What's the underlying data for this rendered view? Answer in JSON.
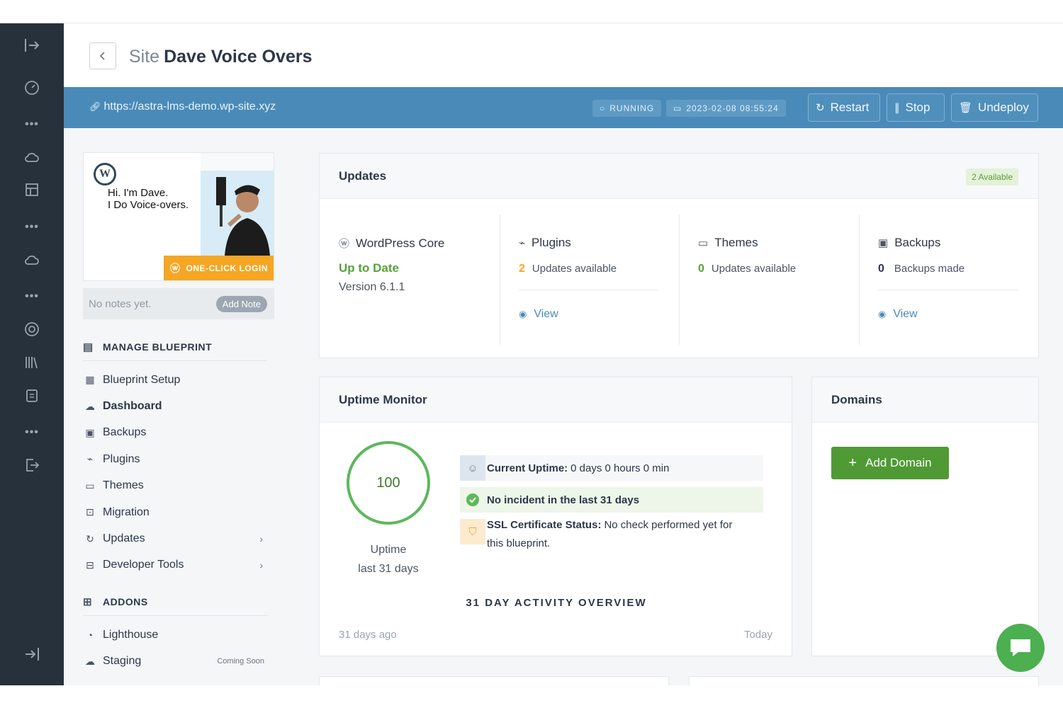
{
  "page": {
    "title_prefix": "Site",
    "title": "Dave Voice Overs"
  },
  "bar": {
    "url": "https://astra-lms-demo.wp-site.xyz",
    "status": "RUNNING",
    "timestamp": "2023-02-08 08:55:24",
    "restart": "Restart",
    "stop": "Stop",
    "undeploy": "Undeploy"
  },
  "preview": {
    "headline_1": "Hi. I'm Dave.",
    "headline_2": "I Do Voice-overs.",
    "one_click": "ONE-CLICK LOGIN"
  },
  "notes": {
    "text": "No notes yet.",
    "add": "Add Note"
  },
  "nav": {
    "manage_heading": "MANAGE BLUEPRINT",
    "items": [
      {
        "label": "Blueprint Setup"
      },
      {
        "label": "Dashboard"
      },
      {
        "label": "Backups"
      },
      {
        "label": "Plugins"
      },
      {
        "label": "Themes"
      },
      {
        "label": "Migration"
      },
      {
        "label": "Updates"
      },
      {
        "label": "Developer Tools"
      }
    ],
    "addons_heading": "ADDONS",
    "addons": [
      {
        "label": "Lighthouse"
      },
      {
        "label": "Staging",
        "badge": "Coming Soon"
      }
    ]
  },
  "updates": {
    "title": "Updates",
    "badge": "2 Available",
    "core": {
      "label": "WordPress Core",
      "status": "Up to Date",
      "version": "Version 6.1.1"
    },
    "plugins": {
      "label": "Plugins",
      "count": "2",
      "text": "Updates available",
      "view": "View"
    },
    "themes": {
      "label": "Themes",
      "count": "0",
      "text": "Updates available"
    },
    "backups": {
      "label": "Backups",
      "count": "0",
      "text": "Backups made",
      "view": "View"
    }
  },
  "uptime": {
    "title": "Uptime Monitor",
    "value": "100",
    "caption_1": "Uptime",
    "caption_2": "last 31 days",
    "current_label": "Current Uptime:",
    "current_value": "0 days 0 hours 0 min",
    "incident": "No incident in the last 31 days",
    "ssl_label": "SSL Certificate Status:",
    "ssl_value_1": "No check performed yet for",
    "ssl_value_2": "this blueprint.",
    "activity": "31 DAY ACTIVITY OVERVIEW",
    "axis_left": "31 days ago",
    "axis_right": "Today"
  },
  "domains": {
    "title": "Domains",
    "add": "Add Domain"
  },
  "colors": {
    "bar": "#4a8ab8",
    "rail": "#27313b",
    "green": "#4f9a34",
    "orange": "#f5a623"
  }
}
